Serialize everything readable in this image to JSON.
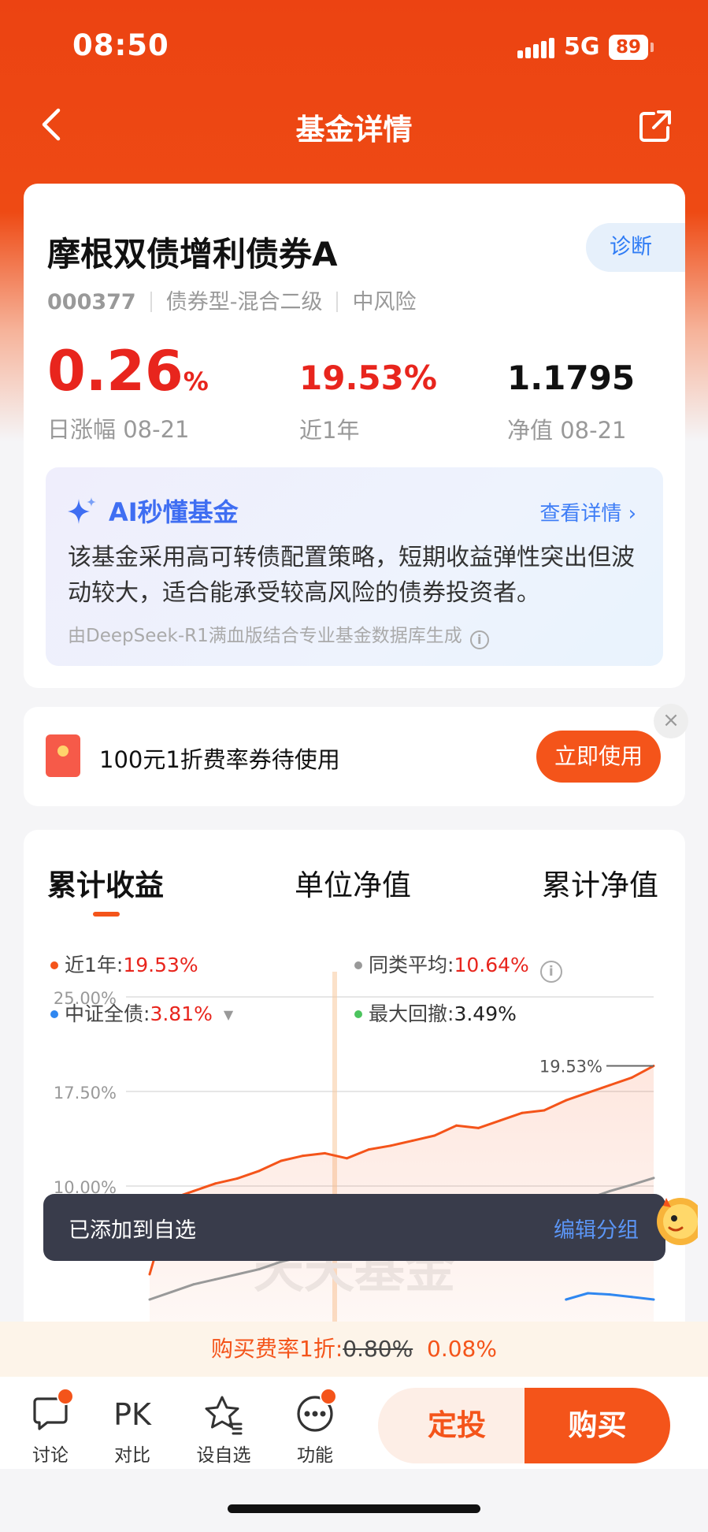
{
  "status": {
    "time": "08:50",
    "network": "5G",
    "battery": "89"
  },
  "nav": {
    "title": "基金详情"
  },
  "fund": {
    "name": "摩根双债增利债券A",
    "diagnose_label": "诊断",
    "code": "000377",
    "type": "债券型-混合二级",
    "risk": "中风险",
    "daily_change": "0.26",
    "daily_change_unit": "%",
    "daily_change_label": "日涨幅 08-21",
    "year_return": "19.53%",
    "year_return_label": "近1年",
    "nav_value": "1.1795",
    "nav_label": "净值 08-21"
  },
  "ai": {
    "title": "AI秒懂基金",
    "more_label": "查看详情 ›",
    "summary": "该基金采用高可转债配置策略，短期收益弹性突出但波动较大，适合能承受较高风险的债券投资者。",
    "source": "由DeepSeek-R1满血版结合专业基金数据库生成"
  },
  "coupon": {
    "text": "100元1折费率券待使用",
    "button": "立即使用",
    "close": "×"
  },
  "chart_tabs": [
    "累计收益",
    "单位净值",
    "累计净值"
  ],
  "legend": {
    "fund_label": "近1年:",
    "fund_value": "19.53%",
    "peer_label": "同类平均:",
    "peer_value": "10.64%",
    "index_label": "中证全债:",
    "index_value": "3.81%",
    "drawdown_label": "最大回撤:",
    "drawdown_value": "3.49%"
  },
  "colors": {
    "fund": "#f4541a",
    "peer": "#999999",
    "index": "#2f87f0",
    "drawdown": "#4cc45e",
    "accent": "#f4541a"
  },
  "chart_data": {
    "type": "line",
    "y_ticks": [
      "25.00%",
      "17.50%",
      "10.00%"
    ],
    "end_label": "19.53%",
    "ylim": [
      0,
      25
    ],
    "watermark": "天天基金",
    "series": [
      {
        "name": "近1年",
        "values": [
          3.0,
          9.0,
          9.6,
          10.2,
          10.6,
          11.2,
          12.0,
          12.4,
          12.6,
          12.2,
          12.9,
          13.2,
          13.6,
          14.0,
          14.8,
          14.6,
          15.2,
          15.8,
          16.0,
          16.8,
          17.4,
          18.0,
          18.6,
          19.53
        ]
      },
      {
        "name": "同类平均",
        "values": [
          1.0,
          1.6,
          2.2,
          2.6,
          3.0,
          3.4,
          4.0,
          4.4,
          4.8,
          4.4,
          5.0,
          5.4,
          5.8,
          6.2,
          6.6,
          7.0,
          7.4,
          7.8,
          8.2,
          8.6,
          9.0,
          9.6,
          10.1,
          10.64
        ]
      },
      {
        "name": "中证全债",
        "values": [
          null,
          null,
          null,
          null,
          null,
          null,
          null,
          null,
          null,
          null,
          null,
          null,
          null,
          null,
          null,
          null,
          null,
          null,
          null,
          1.0,
          1.5,
          1.4,
          1.2,
          1.0
        ]
      }
    ]
  },
  "toast": {
    "text": "已添加到自选",
    "action": "编辑分组"
  },
  "fee": {
    "prefix": "购买费率1折:",
    "old": "0.80%",
    "new": "0.08%"
  },
  "bottom": {
    "discuss": "讨论",
    "compare_icon": "PK",
    "compare": "对比",
    "favorite": "设自选",
    "functions": "功能",
    "sip": "定投",
    "buy": "购买"
  }
}
